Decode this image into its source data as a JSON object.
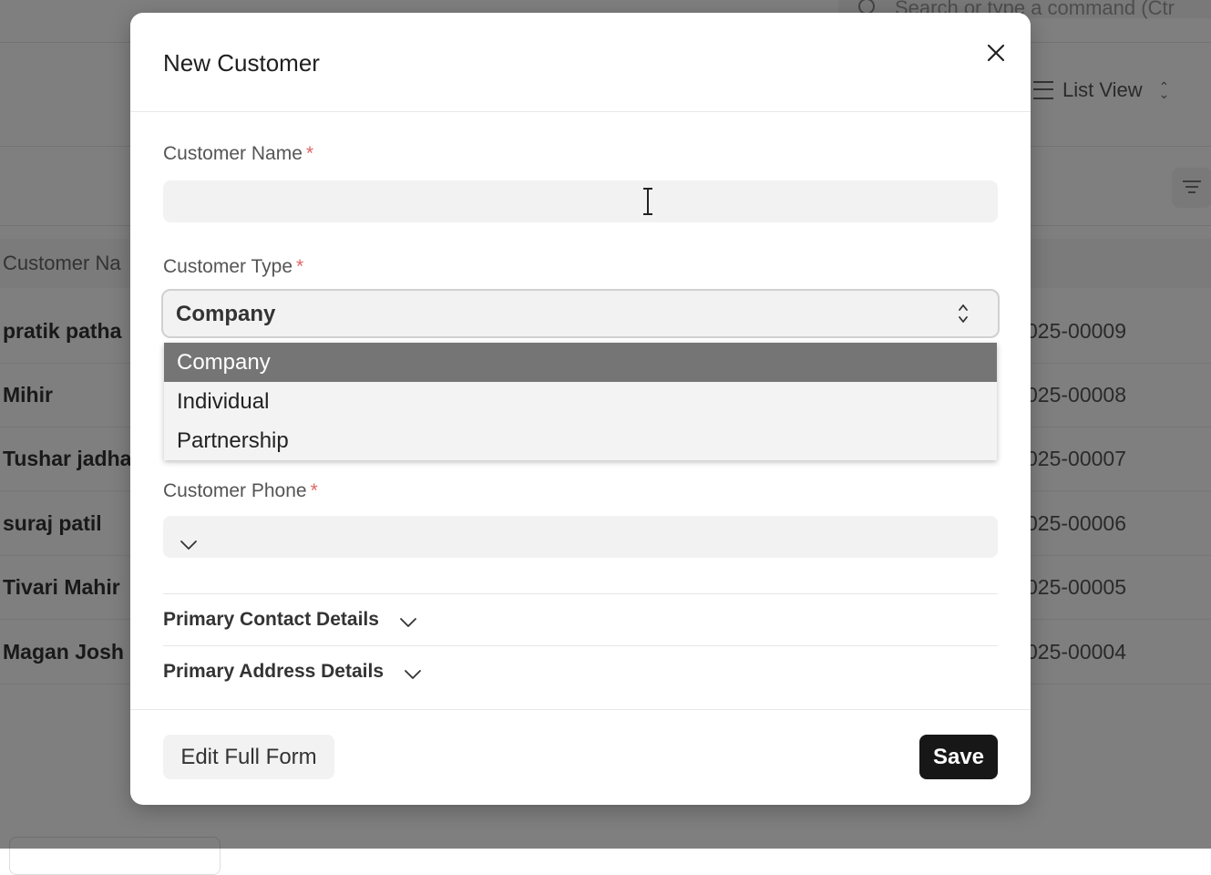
{
  "background": {
    "search_placeholder": "Search or type a command (Ctr",
    "view_selector": "List View",
    "list_header": "Customer Na",
    "rows": [
      {
        "name": "pratik patha",
        "id": "025-00009"
      },
      {
        "name": "Mihir",
        "id": "025-00008"
      },
      {
        "name": "Tushar jadha",
        "id": "025-00007"
      },
      {
        "name": "suraj patil",
        "id": "025-00006"
      },
      {
        "name": "Tivari Mahir",
        "id": "025-00005"
      },
      {
        "name": "Magan Josh",
        "id": "025-00004"
      }
    ]
  },
  "modal": {
    "title": "New Customer",
    "fields": {
      "customer_name": {
        "label": "Customer Name",
        "required_mark": "*",
        "value": ""
      },
      "customer_type": {
        "label": "Customer Type",
        "required_mark": "*",
        "value": "Company",
        "options": [
          "Company",
          "Individual",
          "Partnership"
        ],
        "highlighted": "Company"
      },
      "customer_phone": {
        "label": "Customer Phone",
        "required_mark": "*",
        "value": ""
      }
    },
    "sections": [
      {
        "label": "Primary Contact Details"
      },
      {
        "label": "Primary Address Details"
      }
    ],
    "footer": {
      "edit_full_form": "Edit Full Form",
      "save": "Save"
    }
  },
  "icons": [
    "close-icon",
    "select-arrows-icon",
    "chevron-down-icon",
    "text-cursor-icon",
    "search-icon",
    "list-icon",
    "filter-icon"
  ],
  "colors": {
    "overlay": "#808080",
    "primary_button": "#171717",
    "required": "#e06666",
    "option_highlight": "#757575"
  }
}
